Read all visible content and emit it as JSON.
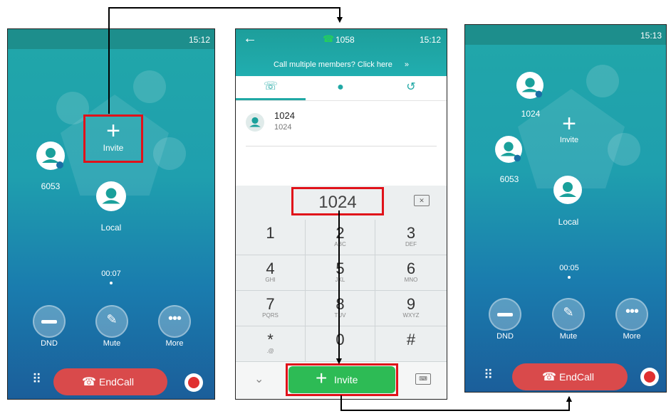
{
  "left": {
    "time": "15:12",
    "invite_label": "Invite",
    "member1_name": "6053",
    "member2_name": "Local",
    "timer": "00:07",
    "controls": [
      "DND",
      "Mute",
      "More"
    ],
    "endcall": "EndCall"
  },
  "middle": {
    "number": "1058",
    "time": "15:12",
    "banner": "Call multiple members? Click here",
    "contact_name": "1024",
    "contact_number": "1024",
    "dial_input": "1024",
    "keys": [
      {
        "d": "1",
        "l": ""
      },
      {
        "d": "2",
        "l": "ABC"
      },
      {
        "d": "3",
        "l": "DEF"
      },
      {
        "d": "4",
        "l": "GHI"
      },
      {
        "d": "5",
        "l": "JKL"
      },
      {
        "d": "6",
        "l": "MNO"
      },
      {
        "d": "7",
        "l": "PQRS"
      },
      {
        "d": "8",
        "l": "TUV"
      },
      {
        "d": "9",
        "l": "WXYZ"
      },
      {
        "d": "*",
        "l": ".@"
      },
      {
        "d": "0",
        "l": ""
      },
      {
        "d": "#",
        "l": ""
      }
    ],
    "invite_button": "Invite"
  },
  "right": {
    "time": "15:13",
    "invite_label": "Invite",
    "member1_name": "1024",
    "member2_name": "6053",
    "member3_name": "Local",
    "timer": "00:05",
    "controls": [
      "DND",
      "Mute",
      "More"
    ],
    "endcall": "EndCall"
  },
  "colors": {
    "highlight": "#e0121a",
    "end_call": "#d94a4b",
    "invite_green": "#2dbb55",
    "teal": "#1d8e8c"
  }
}
